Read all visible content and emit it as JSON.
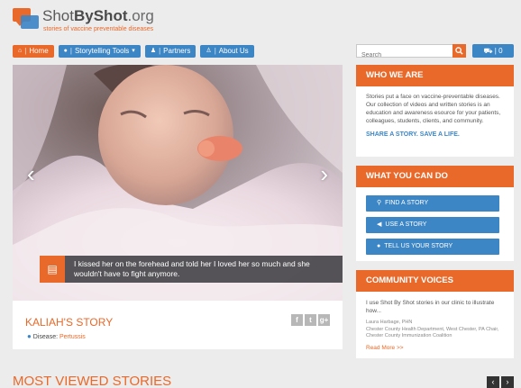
{
  "brand": {
    "shot1": "Shot",
    "by": "By",
    "shot2": "Shot",
    "org": ".org",
    "tagline": "stories of vaccine preventable diseases"
  },
  "nav": {
    "home": "Home",
    "storytelling": "Storytelling Tools",
    "partners": "Partners",
    "about": "About Us"
  },
  "search": {
    "placeholder": "Search"
  },
  "cart": {
    "count": "0"
  },
  "hero": {
    "caption": "I kissed her on the forehead and told her I loved her so much and she wouldn't have to fight anymore."
  },
  "story": {
    "title": "KALIAH'S STORY",
    "disease_label": "Disease:",
    "disease_value": "Pertussis",
    "social": {
      "facebook": "f",
      "twitter": "t",
      "google": "g+"
    }
  },
  "who": {
    "title": "WHO WE ARE",
    "body": "Stories put a face on vaccine-preventable diseases. Our collection of videos and written stories is an education and awareness esource for your patients, colleagues, students, clients, and community.",
    "cta": "SHARE A STORY. SAVE A LIFE."
  },
  "what": {
    "title": "WHAT YOU CAN DO",
    "find": "FIND A STORY",
    "use": "USE A STORY",
    "tell": "TELL US YOUR STORY"
  },
  "voices": {
    "title": "COMMUNITY VOICES",
    "quote": "I use Shot By Shot stories in our clinic to illustrate how...",
    "author_name": "Laura Harbage, PHN",
    "author_org": "Chester County Health Department, West Chester, PA Chair, Chester County Immunization Coalition",
    "more": "Read More >>"
  },
  "most_viewed": {
    "title": "MOST VIEWED STORIES"
  },
  "colors": {
    "orange": "#e8692a",
    "blue": "#3d86c6"
  }
}
